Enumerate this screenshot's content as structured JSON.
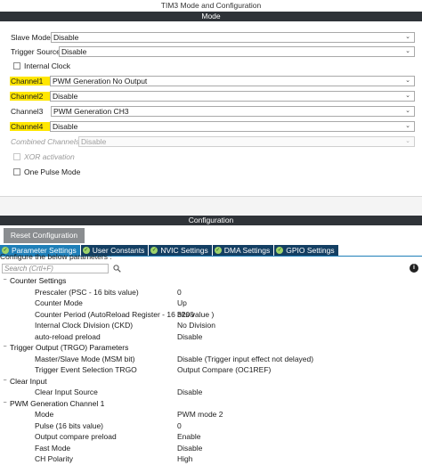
{
  "window_title": "TIM3 Mode and Configuration",
  "mode": {
    "header": "Mode",
    "slave_mode": {
      "label": "Slave Mode",
      "value": "Disable"
    },
    "trigger_source": {
      "label": "Trigger Source",
      "value": "Disable"
    },
    "internal_clock": {
      "label": "Internal Clock",
      "checked": false
    },
    "channel1": {
      "label": "Channel1",
      "value": "PWM Generation No Output"
    },
    "channel2": {
      "label": "Channel2",
      "value": "Disable"
    },
    "channel3": {
      "label": "Channel3",
      "value": "PWM Generation CH3"
    },
    "channel4": {
      "label": "Channel4",
      "value": "Disable"
    },
    "combined_channels": {
      "label": "Combined Channels",
      "value": "Disable"
    },
    "xor_activation": {
      "label": "XOR activation",
      "checked": false
    },
    "one_pulse_mode": {
      "label": "One Pulse Mode",
      "checked": false
    }
  },
  "configuration": {
    "header": "Configuration",
    "reset_button": "Reset Configuration",
    "tabs": [
      {
        "label": "Parameter Settings",
        "active": true
      },
      {
        "label": "User Constants",
        "active": false
      },
      {
        "label": "NVIC Settings",
        "active": false
      },
      {
        "label": "DMA Settings",
        "active": false
      },
      {
        "label": "GPIO Settings",
        "active": false
      }
    ],
    "description": "Configure the below parameters :",
    "search_placeholder": "Search (Crtl+F)",
    "groups": [
      {
        "name": "Counter Settings",
        "params": [
          {
            "name": "Prescaler (PSC - 16 bits value)",
            "value": "0"
          },
          {
            "name": "Counter Mode",
            "value": "Up"
          },
          {
            "name": "Counter Period (AutoReload Register - 16 bits value )",
            "value": "3200"
          },
          {
            "name": "Internal Clock Division (CKD)",
            "value": "No Division"
          },
          {
            "name": "auto-reload preload",
            "value": "Disable"
          }
        ]
      },
      {
        "name": "Trigger Output (TRGO) Parameters",
        "params": [
          {
            "name": "Master/Slave Mode (MSM bit)",
            "value": "Disable (Trigger input effect not delayed)"
          },
          {
            "name": "Trigger Event Selection TRGO",
            "value": "Output Compare (OC1REF)"
          }
        ]
      },
      {
        "name": "Clear Input",
        "params": [
          {
            "name": "Clear Input Source",
            "value": "Disable"
          }
        ]
      },
      {
        "name": "PWM Generation Channel 1",
        "params": [
          {
            "name": "Mode",
            "value": "PWM mode 2"
          },
          {
            "name": "Pulse (16 bits value)",
            "value": "0"
          },
          {
            "name": "Output compare preload",
            "value": "Enable"
          },
          {
            "name": "Fast Mode",
            "value": "Disable"
          },
          {
            "name": "CH Polarity",
            "value": "High"
          }
        ]
      }
    ]
  },
  "colors": {
    "header_bg": "#2f3338",
    "highlight": "#ffe600",
    "tab_bg": "#143f63",
    "tab_active_bg": "#1f7fb8",
    "reset_button_bg": "#8a8d90"
  }
}
